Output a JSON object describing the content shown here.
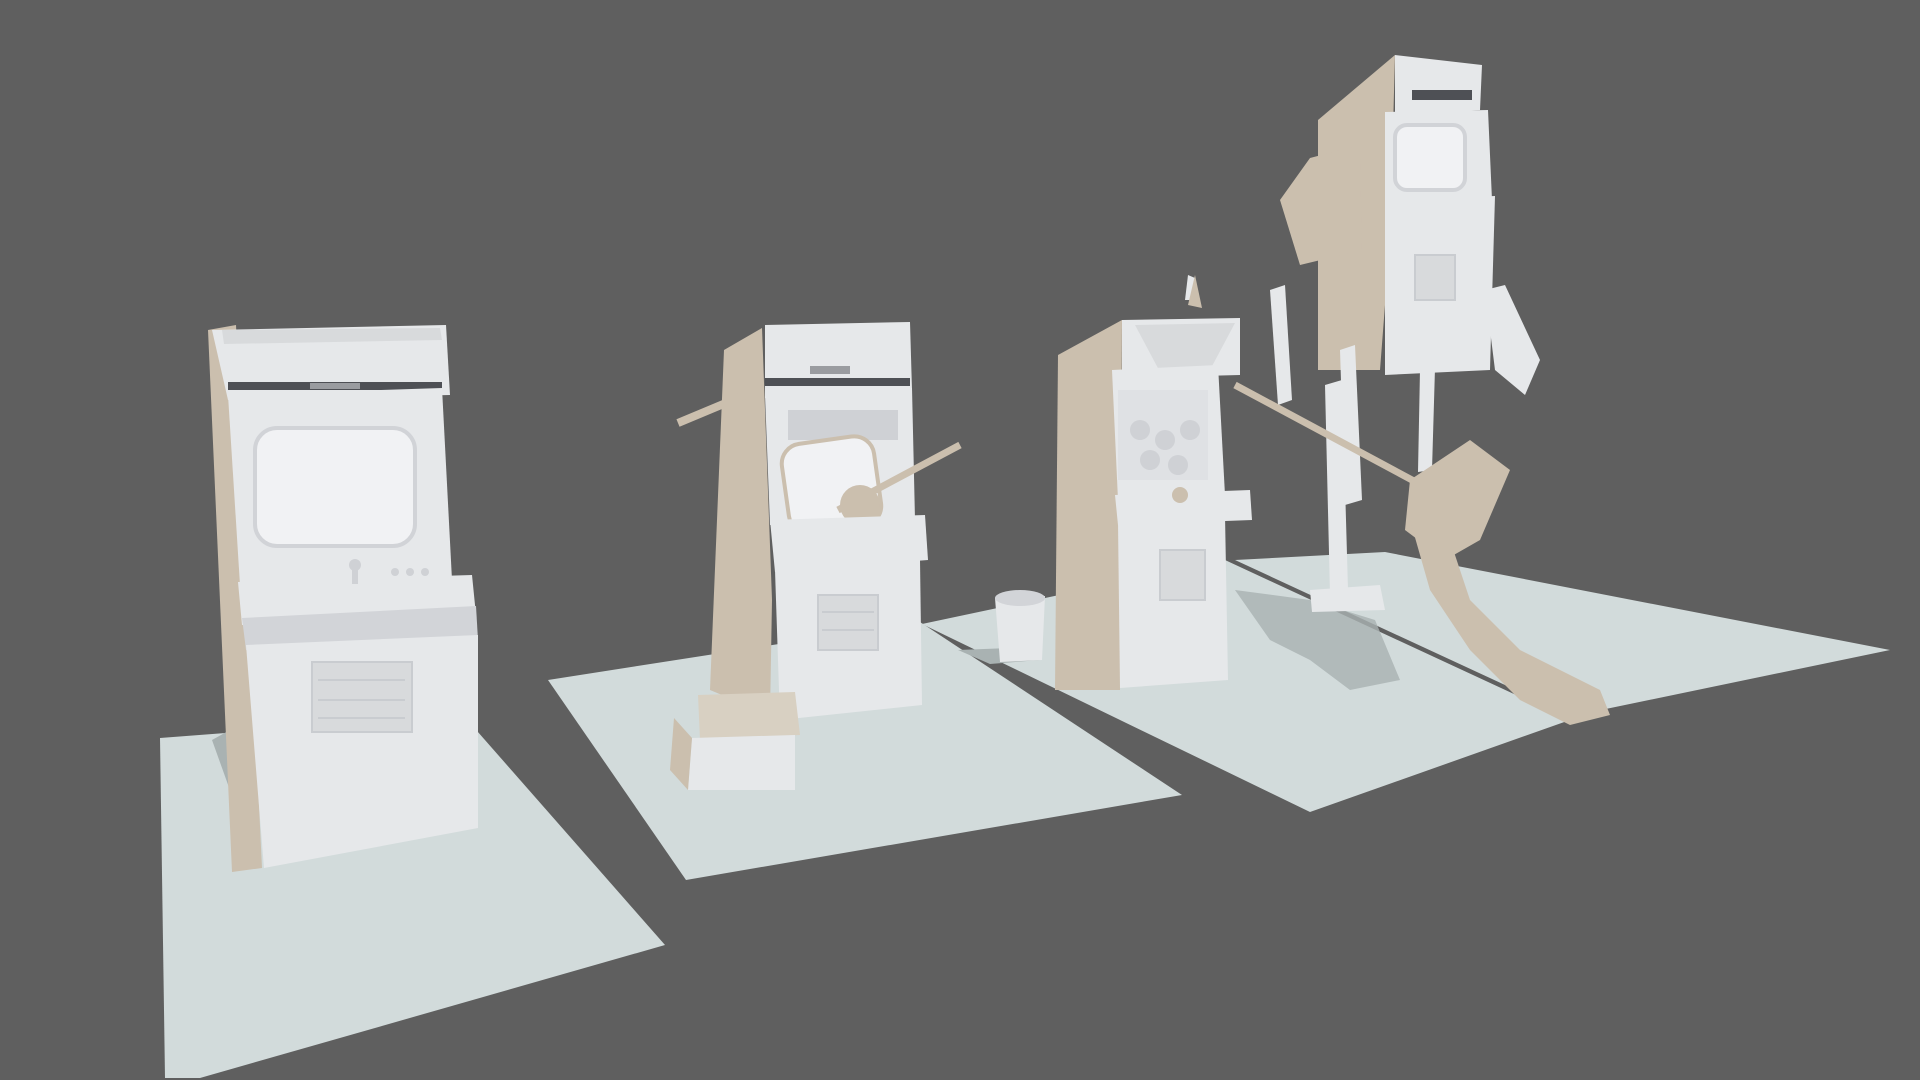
{
  "scene": {
    "description_free": true,
    "colors": {
      "background": "#5f5f5f",
      "floor": "#d2dbdb",
      "floor_shadow": "#a9b2b2",
      "cabinet_front": "#e6e8ea",
      "cabinet_side": "#cbbfae",
      "cabinet_shade": "#b9ad9c",
      "screen": "#f1f2f4",
      "detail": "#c9ccd0"
    },
    "objects": [
      {
        "id": "arcade-cabinet-plain"
      },
      {
        "id": "arcade-cabinet-broken"
      },
      {
        "id": "arcade-cabinet-claw"
      },
      {
        "id": "arcade-cabinet-robot"
      }
    ]
  }
}
